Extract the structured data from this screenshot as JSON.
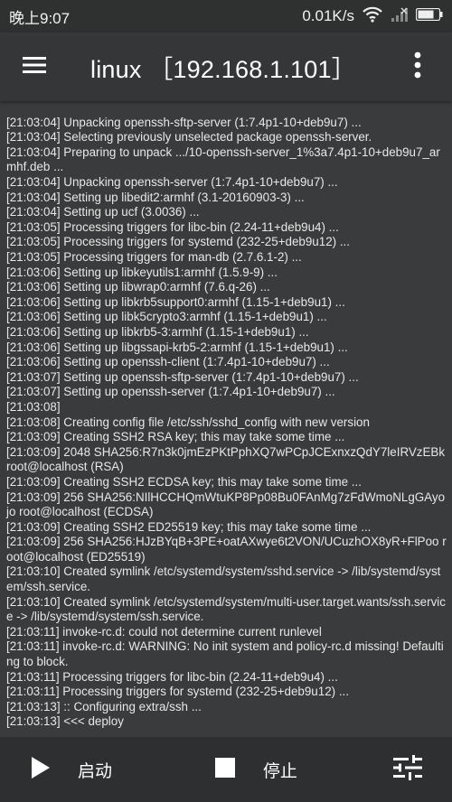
{
  "statusbar": {
    "time": "晚上9:07",
    "net_speed": "0.01K/s"
  },
  "appbar": {
    "title": "linux ［192.168.1.101］"
  },
  "log": {
    "lines": [
      "[21:03:04] Unpacking openssh-sftp-server (1:7.4p1-10+deb9u7) ...",
      "[21:03:04] Selecting previously unselected package openssh-server.",
      "[21:03:04] Preparing to unpack .../10-openssh-server_1%3a7.4p1-10+deb9u7_armhf.deb ...",
      "[21:03:04] Unpacking openssh-server (1:7.4p1-10+deb9u7) ...",
      "[21:03:04] Setting up libedit2:armhf (3.1-20160903-3) ...",
      "[21:03:04] Setting up ucf (3.0036) ...",
      "[21:03:05] Processing triggers for libc-bin (2.24-11+deb9u4) ...",
      "[21:03:05] Processing triggers for systemd (232-25+deb9u12) ...",
      "[21:03:05] Processing triggers for man-db (2.7.6.1-2) ...",
      "[21:03:06] Setting up libkeyutils1:armhf (1.5.9-9) ...",
      "[21:03:06] Setting up libwrap0:armhf (7.6.q-26) ...",
      "[21:03:06] Setting up libkrb5support0:armhf (1.15-1+deb9u1) ...",
      "[21:03:06] Setting up libk5crypto3:armhf (1.15-1+deb9u1) ...",
      "[21:03:06] Setting up libkrb5-3:armhf (1.15-1+deb9u1) ...",
      "[21:03:06] Setting up libgssapi-krb5-2:armhf (1.15-1+deb9u1) ...",
      "[21:03:06] Setting up openssh-client (1:7.4p1-10+deb9u7) ...",
      "[21:03:07] Setting up openssh-sftp-server (1:7.4p1-10+deb9u7) ...",
      "[21:03:07] Setting up openssh-server (1:7.4p1-10+deb9u7) ...",
      "[21:03:08]",
      "[21:03:08] Creating config file /etc/ssh/sshd_config with new version",
      "[21:03:09] Creating SSH2 RSA key; this may take some time ...",
      "[21:03:09] 2048 SHA256:R7n3k0jmEzPKtPphXQ7wPCpJCExnxzQdY7leIRVzEBk root@localhost (RSA)",
      "[21:03:09] Creating SSH2 ECDSA key; this may take some time ...",
      "[21:03:09] 256 SHA256:NIlHCCHQmWtuKP8Pp08Bu0FAnMg7zFdWmoNLgGAyojo root@localhost (ECDSA)",
      "[21:03:09] Creating SSH2 ED25519 key; this may take some time ...",
      "[21:03:09] 256 SHA256:HJzBYqB+3PE+oatAXwye6t2VON/UCuzhOX8yR+FlPoo root@localhost (ED25519)",
      "[21:03:10] Created symlink /etc/systemd/system/sshd.service -> /lib/systemd/system/ssh.service.",
      "[21:03:10] Created symlink /etc/systemd/system/multi-user.target.wants/ssh.service -> /lib/systemd/system/ssh.service.",
      "[21:03:11] invoke-rc.d: could not determine current runlevel",
      "[21:03:11] invoke-rc.d: WARNING: No init system and policy-rc.d missing! Defaulting to block.",
      "[21:03:11] Processing triggers for libc-bin (2.24-11+deb9u4) ...",
      "[21:03:11] Processing triggers for systemd (232-25+deb9u12) ...",
      "[21:03:13] :: Configuring extra/ssh ...",
      "[21:03:13] <<< deploy"
    ]
  },
  "controls": {
    "start_label": "启动",
    "stop_label": "停止"
  },
  "icons": {
    "menu": "menu-icon",
    "more": "more-vert-icon",
    "wifi": "wifi-icon",
    "signal": "signal-icon",
    "battery": "battery-icon",
    "play": "play-icon",
    "stop": "stop-icon",
    "tune": "tune-icon"
  }
}
